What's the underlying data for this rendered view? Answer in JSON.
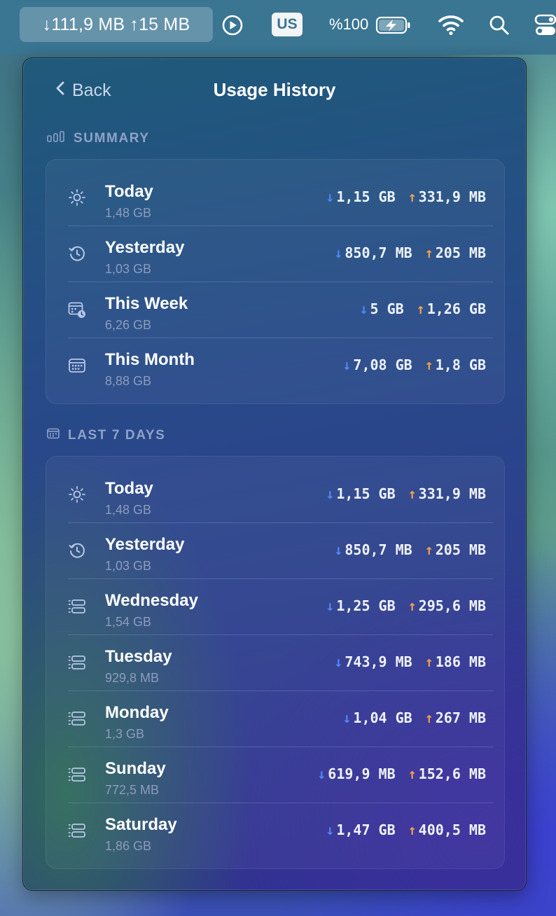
{
  "menubar": {
    "net_status": "↓111,9 MB ↑15 MB",
    "keyboard_layout": "US",
    "battery_percent": "%100"
  },
  "header": {
    "back_label": "Back",
    "title": "Usage History"
  },
  "summary": {
    "title": "SUMMARY",
    "rows": [
      {
        "name": "Today",
        "total": "1,48 GB",
        "down": "1,15 GB",
        "up": "331,9 MB",
        "icon": "sun-icon"
      },
      {
        "name": "Yesterday",
        "total": "1,03 GB",
        "down": "850,7 MB",
        "up": "205 MB",
        "icon": "history-icon"
      },
      {
        "name": "This Week",
        "total": "6,26 GB",
        "down": "5 GB",
        "up": "1,26 GB",
        "icon": "calendar-clock-icon"
      },
      {
        "name": "This Month",
        "total": "8,88 GB",
        "down": "7,08 GB",
        "up": "1,8 GB",
        "icon": "calendar-icon"
      }
    ]
  },
  "last7": {
    "title": "LAST 7 DAYS",
    "rows": [
      {
        "name": "Today",
        "total": "1,48 GB",
        "down": "1,15 GB",
        "up": "331,9 MB",
        "icon": "sun-icon"
      },
      {
        "name": "Yesterday",
        "total": "1,03 GB",
        "down": "850,7 MB",
        "up": "205 MB",
        "icon": "history-icon"
      },
      {
        "name": "Wednesday",
        "total": "1,54 GB",
        "down": "1,25 GB",
        "up": "295,6 MB",
        "icon": "list-icon"
      },
      {
        "name": "Tuesday",
        "total": "929,8 MB",
        "down": "743,9 MB",
        "up": "186 MB",
        "icon": "list-icon"
      },
      {
        "name": "Monday",
        "total": "1,3 GB",
        "down": "1,04 GB",
        "up": "267 MB",
        "icon": "list-icon"
      },
      {
        "name": "Sunday",
        "total": "772,5 MB",
        "down": "619,9 MB",
        "up": "152,6 MB",
        "icon": "list-icon"
      },
      {
        "name": "Saturday",
        "total": "1,86 GB",
        "down": "1,47 GB",
        "up": "400,5 MB",
        "icon": "list-icon"
      }
    ]
  },
  "colors": {
    "download_arrow": "#4f86f7",
    "upload_arrow": "#f0a04b"
  }
}
